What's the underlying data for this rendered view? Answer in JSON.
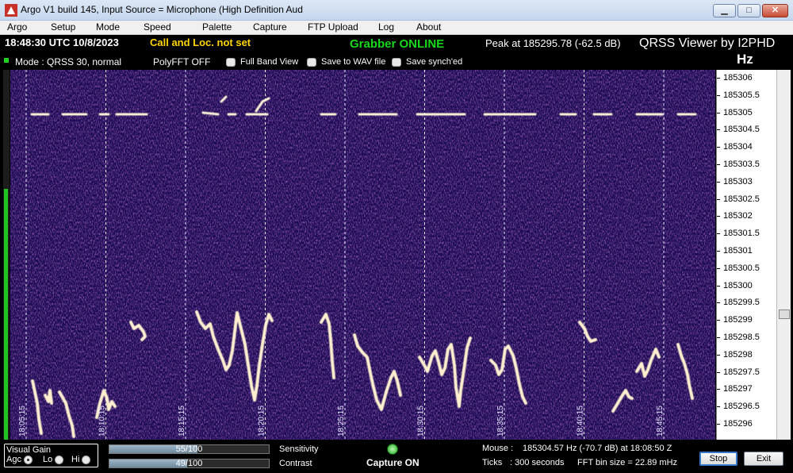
{
  "window": {
    "title": "Argo V1 build 145, Input Source = Microphone (High Definition Aud",
    "min_glyph": "▁",
    "max_glyph": "□",
    "close_glyph": "✕"
  },
  "menu": [
    "Argo",
    "Setup",
    "Mode",
    "Speed",
    "Palette",
    "Capture",
    "FTP Upload",
    "Log",
    "About"
  ],
  "status": {
    "clock": "18:48:30 UTC  10/8/2023",
    "call": "Call and Loc. not set",
    "grabber": "Grabber ONLINE",
    "peak": "Peak at  185295.78 (-62.5 dB)",
    "brand": "QRSS Viewer by I2PHD",
    "hz": "Hz"
  },
  "options": {
    "mode": "Mode : QRSS 30, normal",
    "polyfft": "PolyFFT OFF",
    "full_band": "Full Band View",
    "save_wav": "Save to WAV file",
    "save_synch": "Save synch'ed"
  },
  "time_markers": [
    "18:05:15",
    "18:10:15",
    "18:15:15",
    "18:20:15",
    "18:25:15",
    "18:30:15",
    "18:35:15",
    "18:40:15",
    "18:45:15"
  ],
  "freq_scale": [
    "185306",
    "185305.5",
    "185305",
    "185304.5",
    "185304",
    "185303.5",
    "185303",
    "185302.5",
    "185302",
    "185301.5",
    "185301",
    "185300.5",
    "185300",
    "185299.5",
    "185299",
    "185298.5",
    "185298",
    "185297.5",
    "185297",
    "185296.5",
    "185296"
  ],
  "visual_gain": {
    "title": "Visual Gain",
    "agc": "Agc",
    "lo": "Lo",
    "hi": "Hi",
    "selected": "Agc"
  },
  "sensitivity": {
    "label": "Sensitivity",
    "text": "55/100",
    "value": 55
  },
  "contrast": {
    "label": "Contrast",
    "text": "49/100",
    "value": 49
  },
  "capture": {
    "label": "Capture ON",
    "icon": "status-led-icon"
  },
  "mouse": {
    "label": "Mouse :",
    "value": "185304.57 Hz  (-70.7 dB) at 18:08:50 Z"
  },
  "ticks": {
    "label": "Ticks",
    "value": ": 300 seconds"
  },
  "fft_bin": "FFT bin size = 22.89 mHz",
  "buttons": {
    "stop": "Stop",
    "exit": "Exit"
  },
  "colors": {
    "grabber": "#17d81b",
    "call": "#ffd400",
    "waterfall_bg": "#1a0a52"
  }
}
